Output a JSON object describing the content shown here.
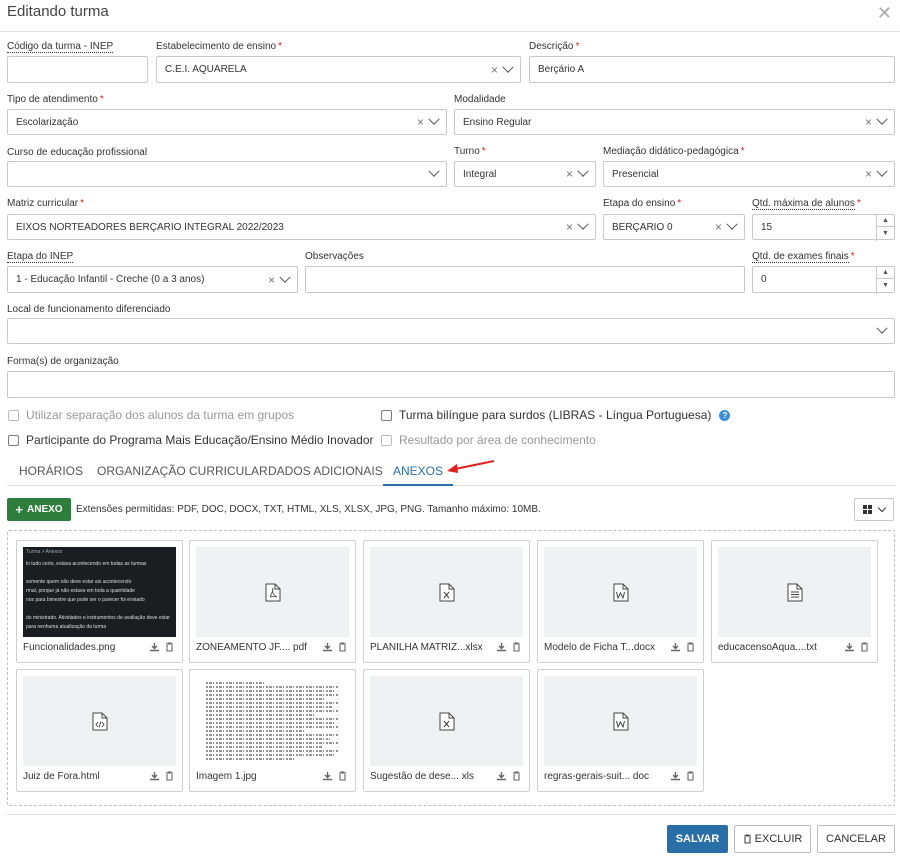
{
  "dialog": {
    "title": "Editando turma"
  },
  "fields": {
    "codigo_inep": {
      "label": "Código da turma - INEP",
      "value": ""
    },
    "estabelecimento": {
      "label": "Estabelecimento de ensino",
      "value": "C.E.I. AQUARELA"
    },
    "descricao": {
      "label": "Descrição",
      "value": "Berçário A"
    },
    "tipo_atendimento": {
      "label": "Tipo de atendimento",
      "value": "Escolarização"
    },
    "modalidade": {
      "label": "Modalidade",
      "value": "Ensino Regular"
    },
    "curso_profissional": {
      "label": "Curso de educação profissional",
      "value": ""
    },
    "turno": {
      "label": "Turno",
      "value": "Integral"
    },
    "mediacao": {
      "label": "Mediação didático-pedagógica",
      "value": "Presencial"
    },
    "matriz": {
      "label": "Matriz curricular",
      "value": "EIXOS NORTEADORES BERÇÁRIO INTEGRAL 2022/2023"
    },
    "etapa_ensino": {
      "label": "Etapa do ensino",
      "value": "BERÇÁRIO 0"
    },
    "qtd_max": {
      "label": "Qtd. máxima de alunos",
      "value": "15"
    },
    "etapa_inep": {
      "label": "Etapa do INEP",
      "value": "1 - Educação Infantil - Creche (0 a 3 anos)"
    },
    "observacoes": {
      "label": "Observações",
      "value": ""
    },
    "qtd_exames": {
      "label": "Qtd. de exames finais",
      "value": "0"
    },
    "local_func": {
      "label": "Local de funcionamento diferenciado",
      "value": ""
    },
    "formas_org": {
      "label": "Forma(s) de organização",
      "value": ""
    }
  },
  "checkboxes": {
    "separacao": "Utilizar separação dos alunos da turma em grupos",
    "bilingue": "Turma bilíngue para surdos (LIBRAS - Língua Portuguesa)",
    "mais_educacao": "Participante do Programa Mais Educação/Ensino Médio Inovador",
    "resultado_area": "Resultado por área de conhecimento"
  },
  "tabs": [
    {
      "label": "HORÁRIOS"
    },
    {
      "label": "ORGANIZAÇÃO CURRICULAR"
    },
    {
      "label": "DADOS ADICIONAIS"
    },
    {
      "label": "ANEXOS"
    }
  ],
  "anexos": {
    "add_label": "ANEXO",
    "extensions_text": "Extensões permitidas: PDF, DOC, DOCX, TXT, HTML, XLS, XLSX, JPG, PNG. Tamanho máximo: 10MB.",
    "files": [
      {
        "name": "Funcionalidades.png",
        "icon": "image-preview"
      },
      {
        "name": "ZONEAMENTO JF.... pdf",
        "icon": "pdf-icon"
      },
      {
        "name": "PLANILHA MATRIZ...xlsx",
        "icon": "excel-icon"
      },
      {
        "name": "Modelo de Ficha T...docx",
        "icon": "word-icon"
      },
      {
        "name": "educacensoAqua....txt",
        "icon": "text-icon"
      },
      {
        "name": "Juiz de Fora.html",
        "icon": "code-icon"
      },
      {
        "name": "Imagem 1.jpg",
        "icon": "image-preview"
      },
      {
        "name": "Sugestão de dese... xls",
        "icon": "excel-icon"
      },
      {
        "name": "regras-gerais-suit... doc",
        "icon": "word-icon"
      }
    ],
    "preview_text": {
      "line1": "Turma > Anexos",
      "line2": "lo tudo certo, estava acontecendo em todas as turmas",
      "line3": "somente quem não deve estar ais acontecendo",
      "line4": "rmal, porque já não estava em toda a quantidade",
      "line5": "nos para bimestre que pode ser o parecer foi enviado",
      "line6": "do ministrado. Atividades e instrumentos de avaliação deve estar",
      "line7": "para nenhuma atualização da turma"
    }
  },
  "footer": {
    "save": "SALVAR",
    "delete": "EXCLUIR",
    "cancel": "CANCELAR"
  },
  "colors": {
    "primary": "#2a6ea8",
    "success": "#2e7d3d",
    "required": "#d9251d",
    "arrow": "#e02020"
  }
}
